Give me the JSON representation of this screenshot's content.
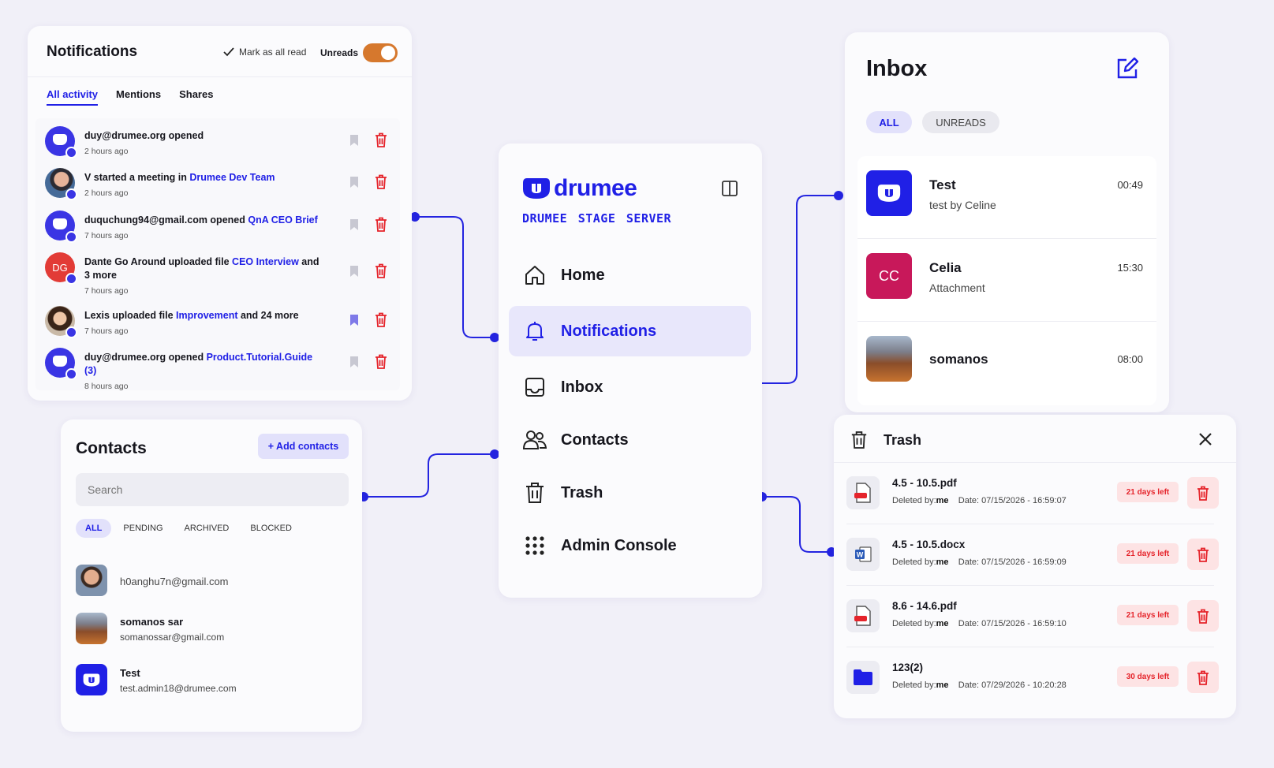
{
  "notifications": {
    "title": "Notifications",
    "mark_read": "Mark as all read",
    "unreads_label": "Unreads",
    "unreads_toggle_on": true,
    "tabs": [
      "All activity",
      "Mentions",
      "Shares"
    ],
    "active_tab": "All activity",
    "items": [
      {
        "pre": "duy@drumee.org opened",
        "link": "",
        "post": "",
        "time": "2 hours ago",
        "avatar": "drumee",
        "bookmarked": false
      },
      {
        "pre": "V started a meeting in ",
        "link": "Drumee Dev Team",
        "post": "",
        "time": "2 hours ago",
        "avatar": "photo",
        "bookmarked": false
      },
      {
        "pre": "duquchung94@gmail.com opened ",
        "link": "QnA CEO Brief",
        "post": "",
        "time": "7 hours ago",
        "avatar": "drumee",
        "bookmarked": false
      },
      {
        "pre": "Dante Go Around uploaded file ",
        "link": "CEO Interview",
        "post": " and 3 more",
        "time": "7 hours ago",
        "avatar": "DG",
        "bookmarked": false
      },
      {
        "pre": "Lexis uploaded file ",
        "link": "Improvement",
        "post": " and 24 more",
        "time": "7 hours ago",
        "avatar": "photo2",
        "bookmarked": true
      },
      {
        "pre": "duy@drumee.org opened ",
        "link": "Product.Tutorial.Guide (3)",
        "post": "",
        "time": "8 hours ago",
        "avatar": "drumee",
        "bookmarked": false
      }
    ]
  },
  "nav": {
    "brand": "drumee",
    "server": "DRUMEE STAGE SERVER",
    "active": "Notifications",
    "items": [
      {
        "label": "Home",
        "icon": "home-icon"
      },
      {
        "label": "Notifications",
        "icon": "bell-icon"
      },
      {
        "label": "Inbox",
        "icon": "inbox-icon"
      },
      {
        "label": "Contacts",
        "icon": "contacts-icon"
      },
      {
        "label": "Trash",
        "icon": "trash-icon"
      },
      {
        "label": "Admin Console",
        "icon": "grid-icon"
      }
    ]
  },
  "inbox": {
    "title": "Inbox",
    "filters": [
      "ALL",
      "UNREADS"
    ],
    "active_filter": "ALL",
    "items": [
      {
        "name": "Test",
        "sub": "test by Celine",
        "time": "00:49",
        "avatar": "drumee"
      },
      {
        "name": "Celia",
        "sub": "Attachment",
        "time": "15:30",
        "avatar": "CC"
      },
      {
        "name": "somanos",
        "sub": "",
        "time": "08:00",
        "avatar": "photo"
      }
    ]
  },
  "contacts": {
    "title": "Contacts",
    "add_label": "+ Add contacts",
    "search_placeholder": "Search",
    "filters": [
      "ALL",
      "PENDING",
      "ARCHIVED",
      "BLOCKED"
    ],
    "active_filter": "ALL",
    "items": [
      {
        "name": "",
        "email": "h0anghu7n@gmail.com",
        "avatar": "photo"
      },
      {
        "name": "somanos sar",
        "email": "somanossar@gmail.com",
        "avatar": "photo2"
      },
      {
        "name": "Test",
        "email": "test.admin18@drumee.com",
        "avatar": "drumee"
      }
    ]
  },
  "trash": {
    "title": "Trash",
    "deleted_by_label": "Deleted by:",
    "deleted_by": "me",
    "date_label": "Date:",
    "items": [
      {
        "name": "4.5 - 10.5.pdf",
        "date": "07/15/2026 - 16:59:07",
        "days": "21 days left",
        "type": "pdf"
      },
      {
        "name": "4.5 - 10.5.docx",
        "date": "07/15/2026 - 16:59:09",
        "days": "21 days left",
        "type": "docx"
      },
      {
        "name": "8.6 - 14.6.pdf",
        "date": "07/15/2026 - 16:59:10",
        "days": "21 days left",
        "type": "pdf"
      },
      {
        "name": "123(2)",
        "date": "07/29/2026 - 10:20:28",
        "days": "30 days left",
        "type": "folder"
      }
    ]
  },
  "colors": {
    "accent": "#2020e6",
    "danger": "#e5242b",
    "toggle": "#d6782d",
    "celia": "#c8185a"
  }
}
